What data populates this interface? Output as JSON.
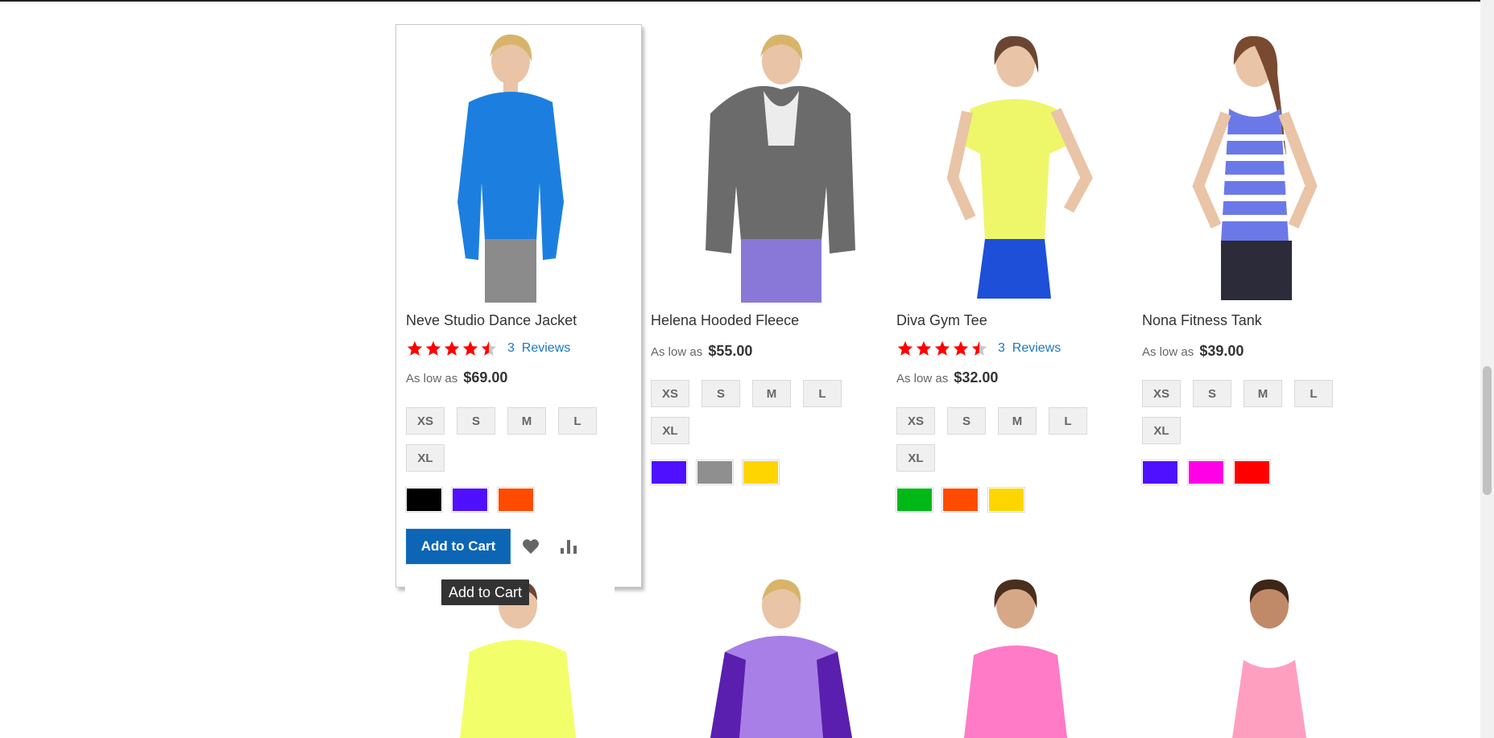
{
  "products": [
    {
      "name": "Neve Studio Dance Jacket",
      "rating_stars": 4.5,
      "reviews_count": "3",
      "reviews_label": "Reviews",
      "price_prefix": "As low as",
      "price": "$69.00",
      "sizes": [
        "XS",
        "S",
        "M",
        "L",
        "XL"
      ],
      "colors": [
        "#000000",
        "#4f10ff",
        "#ff4b00"
      ],
      "add_to_cart": "Add to Cart",
      "garment_color": "#1c7fe0"
    },
    {
      "name": "Helena Hooded Fleece",
      "price_prefix": "As low as",
      "price": "$55.00",
      "sizes": [
        "XS",
        "S",
        "M",
        "L",
        "XL"
      ],
      "colors": [
        "#4f10ff",
        "#8f8f8f",
        "#ffd500"
      ],
      "garment_color": "#6b6b6b"
    },
    {
      "name": "Diva Gym Tee",
      "rating_stars": 4.5,
      "reviews_count": "3",
      "reviews_label": "Reviews",
      "price_prefix": "As low as",
      "price": "$32.00",
      "sizes": [
        "XS",
        "S",
        "M",
        "L",
        "XL"
      ],
      "colors": [
        "#00b917",
        "#ff4b00",
        "#ffd500"
      ],
      "garment_color": "#eef76a"
    },
    {
      "name": "Nona Fitness Tank",
      "price_prefix": "As low as",
      "price": "$39.00",
      "sizes": [
        "XS",
        "S",
        "M",
        "L",
        "XL"
      ],
      "colors": [
        "#4f10ff",
        "#ff00e6",
        "#ff0000"
      ],
      "garment_color": "#6b79e8"
    }
  ],
  "second_row_garments": [
    "#f3ff6a",
    "#a87fe6",
    "#ff7ac7",
    "#ff9fbf"
  ],
  "tooltip": "Add to Cart"
}
